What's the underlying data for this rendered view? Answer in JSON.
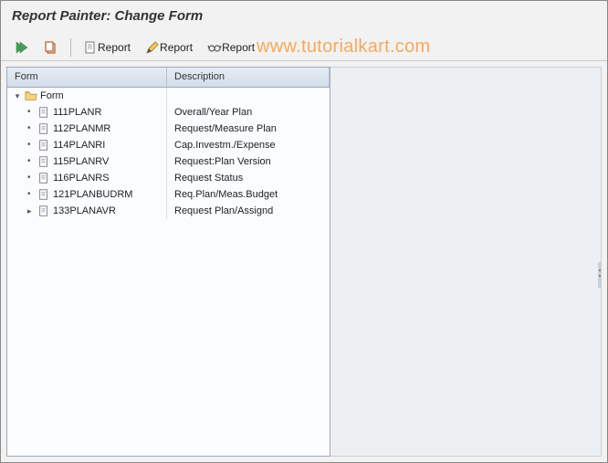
{
  "title": "Report Painter: Change Form",
  "watermark": "www.tutorialkart.com",
  "toolbar": {
    "btn_execute": "",
    "btn_copy": "",
    "btn_report_create": "Report",
    "btn_report_change": "Report",
    "btn_report_display": "Report"
  },
  "tree": {
    "header_form": "Form",
    "header_desc": "Description",
    "root_label": "Form",
    "items": [
      {
        "name": "111PLANR",
        "desc": "Overall/Year Plan"
      },
      {
        "name": "112PLANMR",
        "desc": "Request/Measure Plan"
      },
      {
        "name": "114PLANRI",
        "desc": "Cap.Investm./Expense"
      },
      {
        "name": "115PLANRV",
        "desc": "Request:Plan Version"
      },
      {
        "name": "116PLANRS",
        "desc": "Request Status"
      },
      {
        "name": "121PLANBUDRM",
        "desc": "Req.Plan/Meas.Budget"
      },
      {
        "name": "133PLANAVR",
        "desc": "Request Plan/Assignd"
      }
    ]
  }
}
